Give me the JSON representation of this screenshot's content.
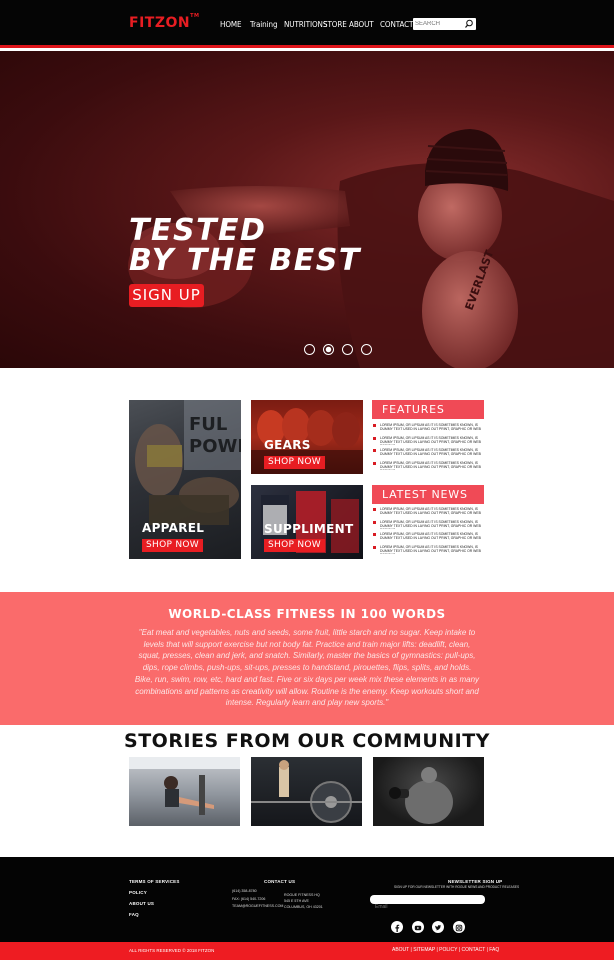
{
  "brand": {
    "name": "FITZON",
    "mark": "TM",
    "accent": "#e81d22"
  },
  "nav": {
    "items": [
      "HOME",
      "Training",
      "NUTRITIONS",
      "STORE",
      "ABOUT",
      "CONTACT"
    ],
    "search_placeholder": "SEARCH"
  },
  "hero": {
    "title_line1": "TESTED",
    "title_line2": "BY THE BEST",
    "cta": "SIGN UP",
    "slides": 4,
    "active_slide": 2
  },
  "tiles": {
    "apparel": {
      "label": "APPAREL",
      "cta": "SHOP NOW"
    },
    "gears": {
      "label": "GEARS",
      "cta": "SHOP NOW"
    },
    "suppliment": {
      "label": "SUPPLIMENT",
      "cta": "SHOP NOW"
    }
  },
  "features": {
    "title": "FEATURES",
    "items": [
      "LOREM IPSUM, OR LIPSUM AS IT IS SOMETIMES KNOWN, IS DUMMY TEXT USED IN LAYING OUT PRINT, GRAPHIC OR WEB DESIGNS.",
      "LOREM IPSUM, OR LIPSUM AS IT IS SOMETIMES KNOWN, IS DUMMY TEXT USED IN LAYING OUT PRINT, GRAPHIC OR WEB DESIGNS.",
      "LOREM IPSUM, OR LIPSUM AS IT IS SOMETIMES KNOWN, IS DUMMY TEXT USED IN LAYING OUT PRINT, GRAPHIC OR WEB DESIGNS.",
      "LOREM IPSUM, OR LIPSUM AS IT IS SOMETIMES KNOWN, IS DUMMY TEXT USED IN LAYING OUT PRINT, GRAPHIC OR WEB DESIGNS."
    ]
  },
  "news": {
    "title": "LATEST NEWS",
    "items": [
      "LOREM IPSUM, OR LIPSUM AS IT IS SOMETIMES KNOWN, IS DUMMY TEXT USED IN LAYING OUT PRINT, GRAPHIC OR WEB DESIGNS.",
      "LOREM IPSUM, OR LIPSUM AS IT IS SOMETIMES KNOWN, IS DUMMY TEXT USED IN LAYING OUT PRINT, GRAPHIC OR WEB DESIGNS.",
      "LOREM IPSUM, OR LIPSUM AS IT IS SOMETIMES KNOWN, IS DUMMY TEXT USED IN LAYING OUT PRINT, GRAPHIC OR WEB DESIGNS.",
      "LOREM IPSUM, OR LIPSUM AS IT IS SOMETIMES KNOWN, IS DUMMY TEXT USED IN LAYING OUT PRINT, GRAPHIC OR WEB DESIGNS."
    ]
  },
  "quote": {
    "title": "WORLD-CLASS FITNESS IN 100 WORDS",
    "text": "\"Eat meat and vegetables, nuts and seeds, some fruit, little starch and no sugar. Keep intake to levels that will support exercise but not body fat. Practice and train major lifts: deadlift, clean, squat, presses, clean and jerk, and snatch. Similarly, master the basics of gymnastics: pull-ups, dips, rope climbs, push-ups, sit-ups, presses to handstand, pirouettes, flips, splits, and holds. Bike, run, swim, row, etc, hard and fast. Five or six days per week mix these elements in as many combinations and patterns as creativity will allow. Routine is the enemy. Keep workouts short and intense. Regularly learn and play new sports.\""
  },
  "stories": {
    "title": "STORIES FROM OUR COMMUNITY"
  },
  "footer": {
    "links": [
      "TERMS OF SERVICES",
      "POLICY",
      "ABOUT US",
      "FAQ"
    ],
    "contact_title": "CONTACT US",
    "phone": "(614) 358-8780",
    "fax": "FAX: (614) 540-7206",
    "email": "TEAM@ROGUEFITNESS.COM",
    "address_1": "ROGUE FITNESS HQ",
    "address_2": "545 E 5TH AVE",
    "address_3": "COLUMBUS, OH 43201",
    "newsletter_title": "NEWSLETTER SIGN UP",
    "newsletter_text": "SIGN UP FOR OUR NEWSLETTER WITH ROGUE NEWS AND PRODUCT RELEASES",
    "email_placeholder": "Email",
    "social": [
      "facebook-icon",
      "youtube-icon",
      "twitter-icon",
      "instagram-icon"
    ],
    "copyright": "ALL RIGHTS RESERVED © 2018 FITZON",
    "bottom_links": "ABOUT  |  SITEMAP  |  POLICY  |  CONTACT  |  FAQ"
  }
}
